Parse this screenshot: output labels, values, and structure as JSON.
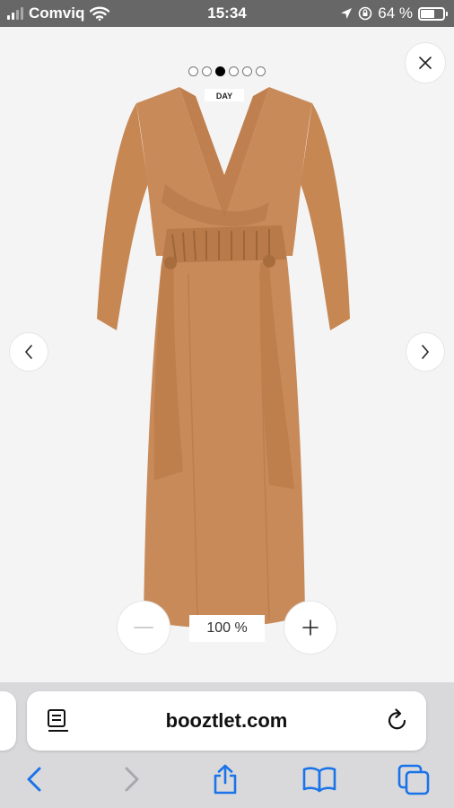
{
  "status_bar": {
    "carrier": "Comviq",
    "time": "15:34",
    "battery_text": "64 %",
    "battery_level": 0.64,
    "signal_bars_active": 2,
    "signal_bars_total": 4
  },
  "viewer": {
    "image_count": 6,
    "active_image_index": 2,
    "zoom_level": "100 %",
    "product_image_label": "DAY"
  },
  "browser": {
    "url": "booztlet.com"
  },
  "colors": {
    "accent_blue": "#1a73e8",
    "dress": "#c98a5a",
    "status_bar": "#676767"
  },
  "icons": {
    "close": "close-icon",
    "prev": "chevron-left-icon",
    "next": "chevron-right-icon",
    "zoom_out": "minus-icon",
    "zoom_in": "plus-icon",
    "reader": "reader-mode-icon",
    "reload": "reload-icon",
    "back": "back-icon",
    "forward": "forward-icon",
    "share": "share-icon",
    "bookmarks": "bookmarks-icon",
    "tabs": "tabs-icon"
  }
}
